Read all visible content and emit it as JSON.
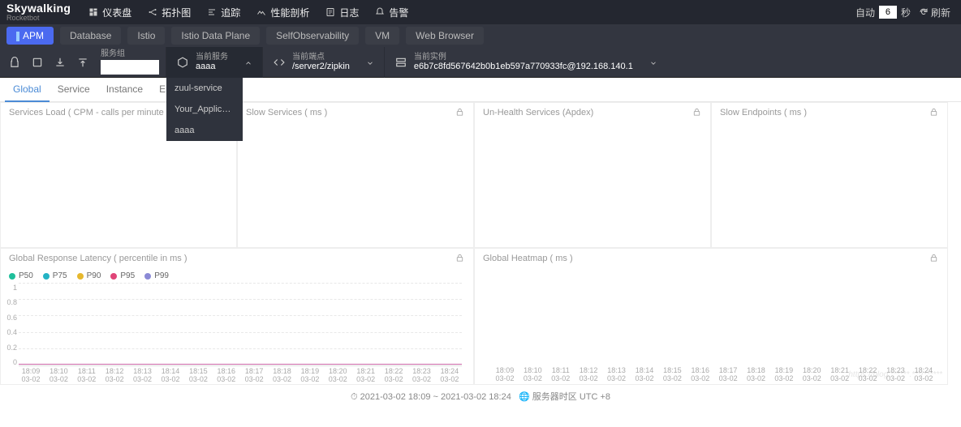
{
  "brand": {
    "main1": "Sky",
    "main2": "walking",
    "sub": "Rocketbot"
  },
  "nav": {
    "dashboard": "仪表盘",
    "topology": "拓扑图",
    "trace": "追踪",
    "profile": "性能剖析",
    "log": "日志",
    "alarm": "告警",
    "auto": "自动",
    "seconds_value": "6",
    "seconds_label": "秒",
    "refresh": "刷新"
  },
  "tabs": {
    "apm": "APM",
    "database": "Database",
    "istio": "Istio",
    "istio_dp": "Istio Data Plane",
    "self": "SelfObservability",
    "vm": "VM",
    "web": "Web Browser"
  },
  "toolbar": {
    "group_label": "服务组",
    "service": {
      "label": "当前服务",
      "value": "aaaa"
    },
    "endpoint": {
      "label": "当前端点",
      "value": "/server2/zipkin"
    },
    "instance": {
      "label": "当前实例",
      "value": "e6b7c8fd567642b0b1eb597a770933fc@192.168.140.1"
    },
    "dropdown": [
      "zuul-service",
      "Your_Applicatio...",
      "aaaa"
    ]
  },
  "subtabs": {
    "global": "Global",
    "service": "Service",
    "instance": "Instance",
    "endpoint": "Endpoint"
  },
  "panels": {
    "load": "Services Load ( CPM - calls per minute )",
    "slow_svc": "Slow Services ( ms )",
    "unhealth": "Un-Health Services (Apdex)",
    "slow_ep": "Slow Endpoints ( ms )",
    "latency": "Global Response Latency ( percentile in ms )",
    "heatmap": "Global Heatmap ( ms )"
  },
  "legend": {
    "p50": "P50",
    "p75": "P75",
    "p90": "P90",
    "p95": "P95",
    "p99": "P99"
  },
  "colors": {
    "p50": "#1fbf9b",
    "p75": "#24b3c4",
    "p90": "#e6b82e",
    "p95": "#e04578",
    "p99": "#8b8ad6"
  },
  "chart_data": {
    "type": "line",
    "ylabels": [
      "1",
      "0.8",
      "0.6",
      "0.4",
      "0.2",
      "0"
    ],
    "ylim": [
      0,
      1
    ],
    "x": [
      "18:09",
      "18:10",
      "18:11",
      "18:12",
      "18:13",
      "18:14",
      "18:15",
      "18:16",
      "18:17",
      "18:18",
      "18:19",
      "18:20",
      "18:21",
      "18:22",
      "18:23",
      "18:24"
    ],
    "x_sub": "03-02",
    "series": [
      {
        "name": "P50",
        "values": [
          0,
          0,
          0,
          0,
          0,
          0,
          0,
          0,
          0,
          0,
          0,
          0,
          0,
          0,
          0,
          0
        ]
      },
      {
        "name": "P75",
        "values": [
          0,
          0,
          0,
          0,
          0,
          0,
          0,
          0,
          0,
          0,
          0,
          0,
          0,
          0,
          0,
          0
        ]
      },
      {
        "name": "P90",
        "values": [
          0,
          0,
          0,
          0,
          0,
          0,
          0,
          0,
          0,
          0,
          0,
          0,
          0,
          0,
          0,
          0
        ]
      },
      {
        "name": "P95",
        "values": [
          0,
          0,
          0,
          0,
          0,
          0,
          0,
          0,
          0,
          0,
          0,
          0,
          0,
          0,
          0,
          0
        ]
      },
      {
        "name": "P99",
        "values": [
          0,
          0,
          0,
          0,
          0,
          0,
          0,
          0,
          0,
          0,
          0,
          0,
          0,
          0,
          0,
          0
        ]
      }
    ]
  },
  "footer": {
    "range": "2021-03-02 18:09 ~ 2021-03-02 18:24",
    "tz": "服务器时区 UTC +8"
  }
}
